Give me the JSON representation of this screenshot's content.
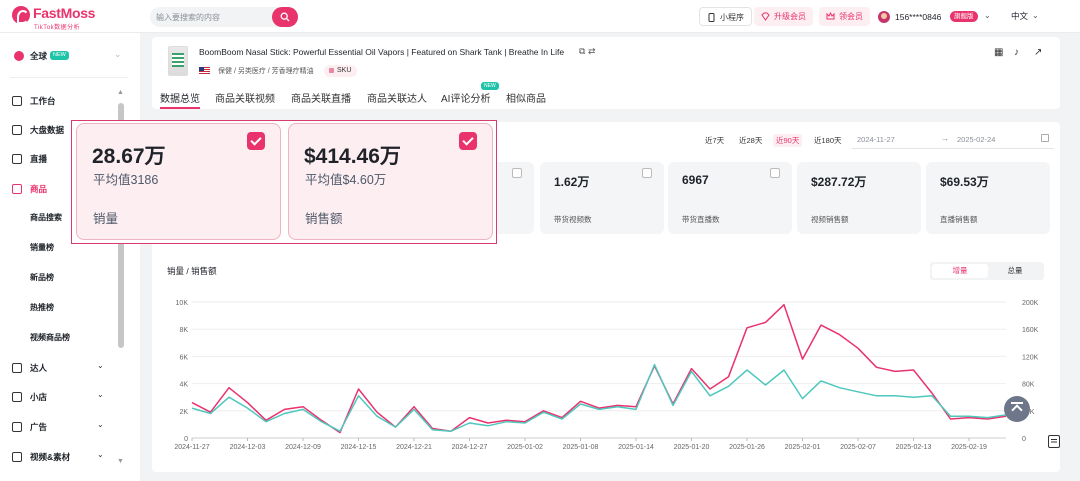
{
  "brand": {
    "name": "FastMoss",
    "sub": "TikTok数据分析",
    "color": "#e8336d"
  },
  "search": {
    "placeholder": "输入要搜索的内容",
    "icon": "search-icon"
  },
  "topbar": {
    "mini_program": "小程序",
    "upgrade": "升级会员",
    "coupon": "领会员",
    "user_phone": "156****0846",
    "user_badge": "旗舰版",
    "language": "中文"
  },
  "sidebar": {
    "region": {
      "label": "全球",
      "badge": "NEW"
    },
    "items": [
      {
        "label": "工作台",
        "icon": "home-icon"
      },
      {
        "label": "大盘数据",
        "icon": "bar-chart-icon"
      },
      {
        "label": "直播",
        "icon": "live-icon"
      },
      {
        "label": "商品",
        "icon": "goods-icon",
        "active": true
      }
    ],
    "sub_items": [
      "商品搜索",
      "销量榜",
      "新品榜",
      "热推榜",
      "视频商品榜"
    ],
    "bottom_items": [
      {
        "label": "达人",
        "icon": "star-person-icon"
      },
      {
        "label": "小店",
        "icon": "shop-icon"
      },
      {
        "label": "广告",
        "icon": "ad-icon"
      },
      {
        "label": "视频&素材",
        "icon": "video-icon"
      }
    ]
  },
  "product": {
    "title": "BoomBoom Nasal Stick: Powerful Essential Oil Vapors | Featured on Shark Tank | Breathe In Life",
    "category": "保健 / 另类医疗 / 芳香理疗精油",
    "sku_label": "SKU",
    "country_flag": "us-flag-icon"
  },
  "tabs": [
    {
      "label": "数据总览",
      "active": true
    },
    {
      "label": "商品关联视频"
    },
    {
      "label": "商品关联直播"
    },
    {
      "label": "商品关联达人"
    },
    {
      "label": "AI评论分析",
      "badge": "NEW"
    },
    {
      "label": "相似商品"
    }
  ],
  "date_filter": {
    "ranges": [
      "近7天",
      "近28天",
      "近90天",
      "近180天"
    ],
    "active": "近90天",
    "start": "2024-11-27",
    "end": "2025-02-24",
    "separator": "→"
  },
  "highlight_cards": [
    {
      "value": "28.67万",
      "avg": "平均值3186",
      "label": "销量",
      "checked": true
    },
    {
      "value": "$414.46万",
      "avg": "平均值$4.60万",
      "label": "销售额",
      "checked": true
    }
  ],
  "metrics": [
    {
      "value": "1.62万",
      "label": "带货视频数"
    },
    {
      "value": "6967",
      "label": "带货直播数"
    },
    {
      "value": "$287.72万",
      "label": "视频销售额"
    },
    {
      "value": "$69.53万",
      "label": "直播销售额"
    }
  ],
  "chart_title": "销量 / 销售额",
  "chart_toggle": {
    "on": "增量",
    "off": "总量"
  },
  "colors": {
    "accent": "#e8336d",
    "sales_line": "#e8336d",
    "amount_line": "#4fc7be"
  },
  "chart_data": {
    "type": "line",
    "title": "销量 / 销售额",
    "x": [
      "2024-11-27",
      "2024-11-29",
      "2024-12-01",
      "2024-12-03",
      "2024-12-05",
      "2024-12-07",
      "2024-12-09",
      "2024-12-11",
      "2024-12-13",
      "2024-12-15",
      "2024-12-17",
      "2024-12-19",
      "2024-12-21",
      "2024-12-23",
      "2024-12-25",
      "2024-12-27",
      "2024-12-29",
      "2024-12-31",
      "2025-01-02",
      "2025-01-04",
      "2025-01-06",
      "2025-01-08",
      "2025-01-10",
      "2025-01-12",
      "2025-01-14",
      "2025-01-16",
      "2025-01-18",
      "2025-01-20",
      "2025-01-22",
      "2025-01-24",
      "2025-01-26",
      "2025-01-28",
      "2025-01-30",
      "2025-02-01",
      "2025-02-03",
      "2025-02-05",
      "2025-02-07",
      "2025-02-09",
      "2025-02-11",
      "2025-02-13",
      "2025-02-15",
      "2025-02-17",
      "2025-02-19",
      "2025-02-21",
      "2025-02-24"
    ],
    "x_ticks": [
      "2024-11-27",
      "2024-12-03",
      "2024-12-09",
      "2024-12-15",
      "2024-12-21",
      "2024-12-27",
      "2025-01-02",
      "2025-01-08",
      "2025-01-14",
      "2025-01-20",
      "2025-01-26",
      "2025-02-01",
      "2025-02-07",
      "2025-02-13",
      "2025-02-19"
    ],
    "y_left": {
      "ticks": [
        "0",
        "2K",
        "4K",
        "6K",
        "8K",
        "10K"
      ],
      "range": [
        0,
        10000
      ]
    },
    "y_right": {
      "ticks": [
        "0",
        "40K",
        "80K",
        "120K",
        "160K",
        "200K"
      ],
      "range": [
        0,
        200000
      ]
    },
    "series": [
      {
        "axis": "left",
        "color": "#e8336d",
        "values": [
          2600,
          1900,
          3700,
          2600,
          1300,
          2100,
          2300,
          1300,
          400,
          3600,
          1900,
          800,
          2300,
          700,
          500,
          1500,
          1100,
          1300,
          1200,
          2000,
          1500,
          2700,
          2200,
          2400,
          2300,
          5300,
          2500,
          5100,
          3600,
          4500,
          8100,
          8500,
          9800,
          5800,
          8300,
          7600,
          6600,
          5200,
          4900,
          5000,
          3300,
          1400,
          1500,
          1400,
          1600
        ]
      },
      {
        "axis": "right",
        "color": "#4fc7be",
        "values": [
          44000,
          36000,
          60000,
          44000,
          24000,
          36000,
          42000,
          24000,
          10000,
          62000,
          32000,
          16000,
          42000,
          12000,
          10000,
          22000,
          18000,
          24000,
          22000,
          38000,
          28000,
          50000,
          42000,
          46000,
          42000,
          108000,
          48000,
          98000,
          62000,
          76000,
          100000,
          78000,
          100000,
          58000,
          84000,
          74000,
          68000,
          62000,
          62000,
          60000,
          62000,
          32000,
          32000,
          30000,
          34000
        ]
      }
    ],
    "grid": true
  }
}
